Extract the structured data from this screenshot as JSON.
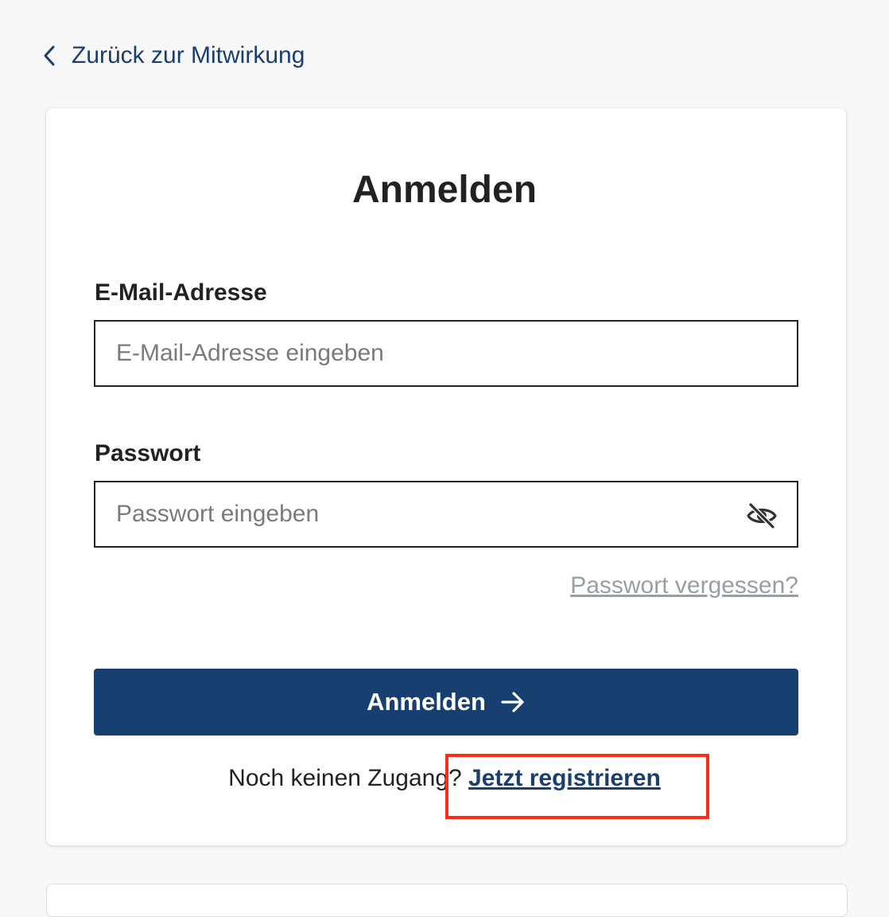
{
  "back_link": {
    "label": "Zurück zur Mitwirkung",
    "icon": "chevron-left-icon"
  },
  "login_card": {
    "title": "Anmelden",
    "email": {
      "label": "E-Mail-Adresse",
      "placeholder": "E-Mail-Adresse eingeben",
      "value": ""
    },
    "password": {
      "label": "Passwort",
      "placeholder": "Passwort eingeben",
      "value": "",
      "toggle_icon": "eye-slash-icon"
    },
    "forgot_password": "Passwort vergessen?",
    "submit_label": "Anmelden",
    "submit_icon": "arrow-right-icon",
    "register_prompt": "Noch keinen Zugang? ",
    "register_link": "Jetzt registrieren"
  },
  "colors": {
    "primary": "#173f6f",
    "link": "#1a3e6e",
    "muted_link": "#9a9da3",
    "background": "#f7f7f7",
    "highlight": "#ff2a1a"
  }
}
